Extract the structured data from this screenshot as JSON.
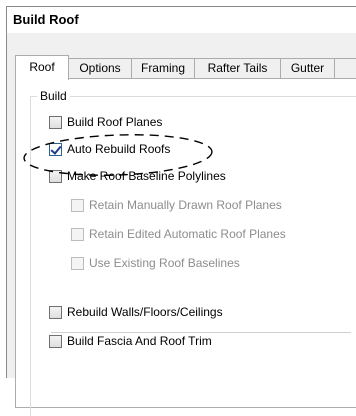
{
  "window": {
    "title": "Build Roof"
  },
  "tabs": [
    {
      "label": "Roof",
      "active": true
    },
    {
      "label": "Options",
      "active": false
    },
    {
      "label": "Framing",
      "active": false
    },
    {
      "label": "Rafter Tails",
      "active": false
    },
    {
      "label": "Gutter",
      "active": false
    },
    {
      "label": "",
      "active": false
    }
  ],
  "build_group": {
    "label": "Build",
    "options": [
      {
        "label": "Build Roof Planes",
        "checked": false,
        "enabled": true
      },
      {
        "label": "Auto Rebuild Roofs",
        "checked": true,
        "enabled": true
      },
      {
        "label": "Make Roof Baseline Polylines",
        "checked": false,
        "enabled": true
      },
      {
        "label": "Retain Manually Drawn Roof Planes",
        "checked": false,
        "enabled": false
      },
      {
        "label": "Retain Edited Automatic Roof Planes",
        "checked": false,
        "enabled": false
      },
      {
        "label": "Use Existing Roof Baselines",
        "checked": false,
        "enabled": false
      },
      {
        "label": "Rebuild Walls/Floors/Ceilings",
        "checked": false,
        "enabled": true
      },
      {
        "label": "Build Fascia And Roof Trim",
        "checked": false,
        "enabled": true
      }
    ]
  },
  "colors": {
    "highlight_ellipse": "#000000",
    "tab_border": "#acacac",
    "disabled_text": "#8d8d8d"
  }
}
